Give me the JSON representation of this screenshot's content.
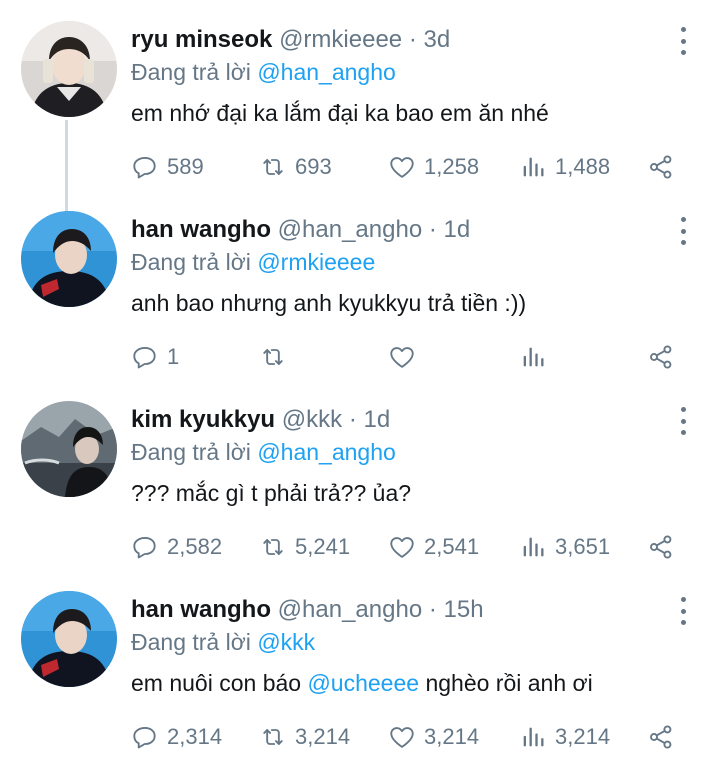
{
  "colors": {
    "text": "#14171a",
    "secondary": "#657786",
    "link": "#1da1f2",
    "thread_line": "#cfd9de"
  },
  "icons": {
    "reply": "reply-icon",
    "retweet": "retweet-icon",
    "like": "heart-icon",
    "views": "views-icon",
    "share": "share-icon",
    "more": "more-vertical-icon"
  },
  "replying_to_label": "Đang trả lời",
  "tweets": [
    {
      "name": "ryu minseok",
      "handle": "@rmkieeee",
      "time": "3d",
      "reply_to": "@han_angho",
      "text_before": "em nhớ đại ka lắm đại ka bao em ăn nhé",
      "mention": "",
      "text_after": "",
      "replies": "589",
      "retweets": "693",
      "likes": "1,258",
      "views": "1,488"
    },
    {
      "name": "han wangho",
      "handle": "@han_angho",
      "time": "1d",
      "reply_to": "@rmkieeee",
      "text_before": "anh bao nhưng anh kyukkyu trả tiền :))",
      "mention": "",
      "text_after": "",
      "replies": "1",
      "retweets": "",
      "likes": "",
      "views": ""
    },
    {
      "name": "kim kyukkyu",
      "handle": "@kkk",
      "time": "1d",
      "reply_to": "@han_angho",
      "text_before": "??? mắc gì t phải trả?? ủa?",
      "mention": "",
      "text_after": "",
      "replies": "2,582",
      "retweets": "5,241",
      "likes": "2,541",
      "views": "3,651"
    },
    {
      "name": "han wangho",
      "handle": "@han_angho",
      "time": "15h",
      "reply_to": "@kkk",
      "text_before": "em nuôi con báo ",
      "mention": "@ucheeee",
      "text_after": " nghèo rồi anh ơi",
      "replies": "2,314",
      "retweets": "3,214",
      "likes": "3,214",
      "views": "3,214"
    }
  ]
}
